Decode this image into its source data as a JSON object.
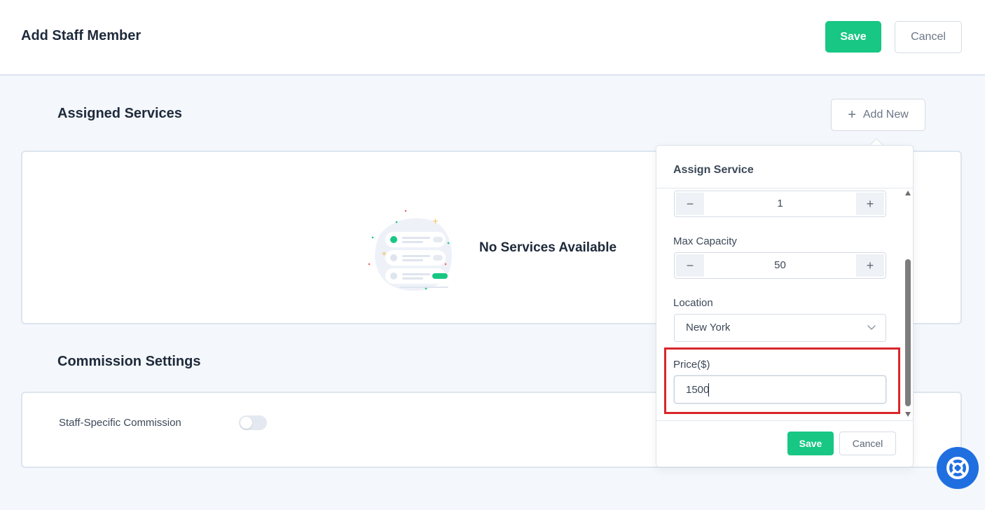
{
  "header": {
    "title": "Add Staff Member",
    "save_label": "Save",
    "cancel_label": "Cancel"
  },
  "assigned_services": {
    "title": "Assigned Services",
    "add_new_label": "Add New",
    "empty_text": "No Services Available"
  },
  "commission": {
    "title": "Commission Settings",
    "staff_specific_label": "Staff-Specific Commission",
    "staff_specific_enabled": false
  },
  "assign_service_popover": {
    "title": "Assign Service",
    "first_stepper_value": "1",
    "max_capacity": {
      "label": "Max Capacity",
      "value": "50"
    },
    "location": {
      "label": "Location",
      "value": "New York"
    },
    "price": {
      "label": "Price($)",
      "value": "1500"
    },
    "save_label": "Save",
    "cancel_label": "Cancel"
  },
  "colors": {
    "accent_green": "#17c783",
    "highlight_red": "#d9262b",
    "help_blue": "#1f6fe0"
  },
  "icons": {
    "add": "plus-icon",
    "decrement": "minus-icon",
    "increment": "plus-icon",
    "dropdown": "chevron-down-icon",
    "help": "lifebuoy-icon"
  }
}
